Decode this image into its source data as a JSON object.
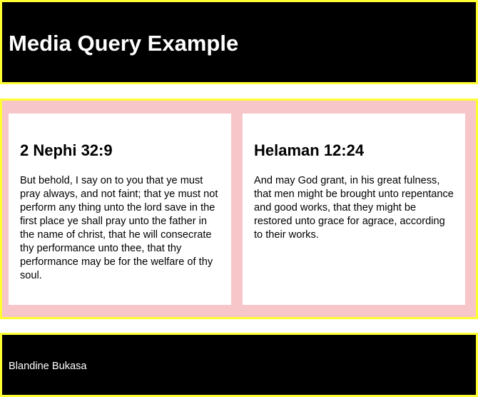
{
  "header": {
    "title": "Media Query Example"
  },
  "cards": [
    {
      "heading": "2 Nephi 32:9",
      "text": "But behold, I say on to you that ye must pray always, and not faint; that ye must not perform any thing unto the lord save in the first place ye shall pray unto the father in the name of christ, that he will consecrate thy performance unto thee, that thy performance may be for the welfare of thy soul."
    },
    {
      "heading": "Helaman 12:24",
      "text": "And may God grant, in his great fulness, that men might be brought unto repentance and good works, that they might be restored unto grace for agrace, according to their works."
    }
  ],
  "footer": {
    "author": "Blandine Bukasa"
  },
  "colors": {
    "header_bg": "#000000",
    "border": "#ffff33",
    "content_bg": "#f7c6c8",
    "card_bg": "#ffffff"
  }
}
